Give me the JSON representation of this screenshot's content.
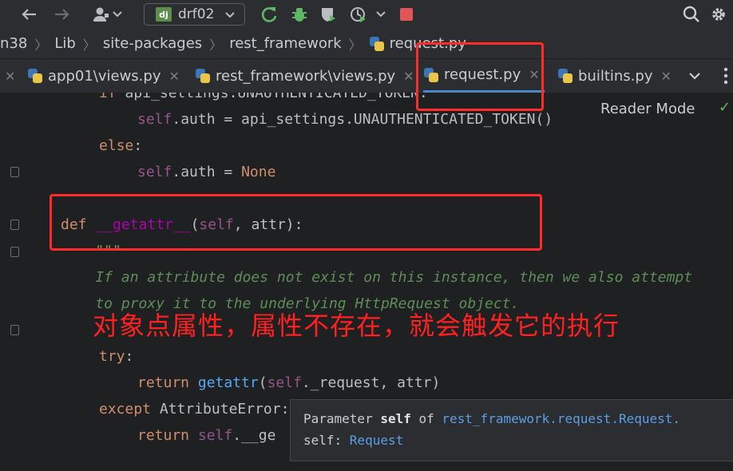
{
  "toolbar": {
    "project": "drf02",
    "project_badge": "dj",
    "icons": [
      "back-arrow",
      "forward-arrow",
      "user",
      "dropdown",
      "run",
      "debug",
      "coverage",
      "profile",
      "dropdown",
      "stop",
      "search",
      "settings"
    ]
  },
  "breadcrumb": {
    "items": [
      "n38",
      "Lib",
      "site-packages",
      "rest_framework",
      "request.py"
    ]
  },
  "tabs": [
    {
      "label": "app01\\views.py",
      "active": false
    },
    {
      "label": "rest_framework\\views.py",
      "active": false
    },
    {
      "label": "request.py",
      "active": true
    },
    {
      "label": "builtins.py",
      "active": false
    }
  ],
  "editor": {
    "reader_mode": "Reader Mode",
    "lines": [
      {
        "t0": "    ",
        "k": "if",
        "rest": " api_settings.UNAUTHENTICATED_TOKEN:"
      },
      {
        "t0": "        ",
        "self": "self",
        "rest": ".auth = api_settings.UNAUTHENTICATED_TOKEN()"
      },
      {
        "t0": "    ",
        "k": "else",
        "rest": ":"
      },
      {
        "t0": "        ",
        "self": "self",
        "rest": ".auth = ",
        "none": "None"
      },
      {
        "t0": ""
      },
      {
        "def": "def",
        "name": "__getattr__",
        "args_open": "(",
        "self": "self",
        "args_rest": ", attr):"
      },
      {
        "doc": "    \"\"\""
      },
      {
        "doc": "    If an attribute does not exist on this instance, then we also attempt"
      },
      {
        "doc": "    to proxy it to the underlying HttpRequest object."
      },
      {
        "doc": "    \"\"\""
      },
      {
        "k": "try",
        "rest": ":"
      },
      {
        "ret": "return",
        "call": "getattr",
        "self": "self",
        "rest": "._request, attr)"
      },
      {
        "k": "except",
        "rest": " AttributeError:"
      },
      {
        "ret": "return",
        "self": "self",
        "rest": ".__ge"
      }
    ]
  },
  "annotation": "对象点属性，属性不存在，就会触发它的执行",
  "tooltip": {
    "line1_prefix": "Parameter ",
    "line1_bold": "self",
    "line1_of": " of ",
    "line1_link": "rest_framework.request.Request.",
    "line2_prefix": "self: ",
    "line2_link": "Request"
  },
  "colors": {
    "highlight_box": "#ff2a2a",
    "annotation": "#ff2020",
    "active_tab": "#4a88c7"
  }
}
